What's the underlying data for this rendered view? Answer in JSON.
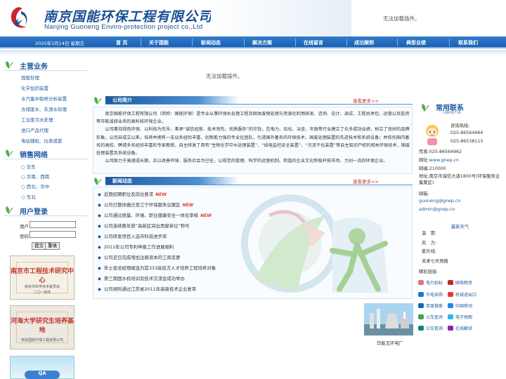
{
  "header": {
    "logo_cn": "南京国能环保工程有限公司",
    "logo_en": "Nanjing Guoneng Enviro-protection project co.,Ltd",
    "flash_placeholder": "无法加载插件。"
  },
  "nav": {
    "date": "2025年3月14日 星期五",
    "items": [
      "首 页",
      "关于国能",
      "新闻动态",
      "解决方案",
      "在线留言",
      "成功案例",
      "典型业绩",
      "联系我们"
    ]
  },
  "left": {
    "business": {
      "title": "主营业务",
      "items": [
        "固废处理",
        "化学加药装置",
        "水汽集中取样分析装置",
        "含煤废水、灰渣水处理",
        "工业废污水处理",
        "进口产品代理",
        "电站辅机、仪表成套"
      ]
    },
    "sales": {
      "title": "销售网络",
      "items": [
        "华东",
        "华南、西南",
        "西北、华中",
        "东北"
      ]
    },
    "login": {
      "title": "用户登录",
      "user_label": "用户:",
      "pass_label": "密码:",
      "submit": "提交",
      "reset": "重填"
    },
    "certs": [
      {
        "title": "南京市工程技术研究中心",
        "sub1": "南京市科学技术委员会",
        "sub2": "二〇一四年"
      },
      {
        "title": "河海大学研究生培养基地",
        "sub1": "南京国能环保工程有限公司",
        "sub2": ""
      }
    ],
    "qa_label": "QA"
  },
  "center": {
    "flash_placeholder": "无法加载插件。",
    "intro": {
      "title": "公司简介",
      "more": "查看更多>>",
      "paragraphs": [
        "南京国能环保工程有限公司（简称：国能环保）是专业从事环保水处理工程及固体废物处理与资源化利用研发、咨询、设计、调试、工程总承包、运营以及投资等市能减排业务的高科技环保企业。",
        "公司秉持绿色环保、以科技为先导，秉承“诚信经营、技术领先、优质服务”的宗旨。在电力、石化、冶金、市政等行业建立了众多成功业绩，树立了良好的品牌形象。公司自成立以来，培养并拥有一支业务经验丰富、创新能力强的专业化团队，引进国外著名的环保技术，国废处理装置的先进技术和系统设备；并依托国内著名的高校、聘请多名经验丰富的专家教授，自主研发了具有“生物化学中水处理装置”、“线电监控安全装置”、“污泥干化装置”等自主知识产权的相关环保技术，国废处理装置及系统设备。",
        "公司致力于高速成长期，正以改善环境、服务社会为已任，以规范的管理、科学的运营机制、和谐的企业文化积极开拓市场，力创一流的环保企业。"
      ]
    },
    "news": {
      "title": "新闻动态",
      "more": "查看更多>>",
      "new_badge": "NEW",
      "items": [
        {
          "text": "近期招聘职位及岗位要求",
          "new": true
        },
        {
          "text": "公司已整体搬迁至江宁环保服务业聚区",
          "new": true
        },
        {
          "text": "公司通过质量、环境、职业健康安全一体化审核",
          "new": true
        },
        {
          "text": "公司连续数年获“高新区突出贡献单位”称号",
          "new": false
        },
        {
          "text": "公司研发项目入选市科技进步奖",
          "new": false
        },
        {
          "text": "2011年公司专利申报工作进展顺利",
          "new": false
        },
        {
          "text": "公司近日完成增加注册资本的工商变更",
          "new": false
        },
        {
          "text": "朱士奎总经理被选为首333高层次人才培养工程培养对象",
          "new": false
        },
        {
          "text": "第三期国水机培训及技术交流会成功举办",
          "new": false
        },
        {
          "text": "公司顺利通过江苏省2011年高新技术企业复审",
          "new": false
        }
      ]
    }
  },
  "right": {
    "contact": {
      "title": "常用联系",
      "subtitle": "CONTACT US",
      "hotline_label": "咨询热线:",
      "phone1": "025-86564964",
      "phone2": "025-86538115",
      "fax": "传真:025-86564962",
      "web_label": "网址:",
      "web": "www.gnep.cn",
      "zip": "邮编:210000",
      "addr": "地址:南京市诚信大道1800号(环保服务业集聚区)",
      "email_label": "邮箱:",
      "email1": "guoneng@gnep.cn",
      "email2": "admin@gnep.cn"
    },
    "weather": {
      "title": "最新天气",
      "temp": "温　度:",
      "wind": "风　力:",
      "uv": "紫外线:",
      "forecast": "未来七天预报"
    },
    "links": {
      "title": "精彩链接:",
      "items": [
        {
          "label": "电力招标",
          "color": "#e57373"
        },
        {
          "label": "国电物资",
          "color": "#c62828"
        },
        {
          "label": "华电采购",
          "color": "#1976d2"
        },
        {
          "label": "机械进出口",
          "color": "#e53935"
        },
        {
          "label": "百度搜索",
          "color": "#1565c0"
        },
        {
          "label": "中国移动",
          "color": "#1e88e5"
        },
        {
          "label": "火车查询",
          "color": "#43a047"
        },
        {
          "label": "电子地图",
          "color": "#29b6f6"
        },
        {
          "label": "公交查询",
          "color": "#00897b"
        },
        {
          "label": "在线翻译",
          "color": "#8e24aa"
        }
      ]
    },
    "plant_caption": "华能玉环电厂"
  }
}
